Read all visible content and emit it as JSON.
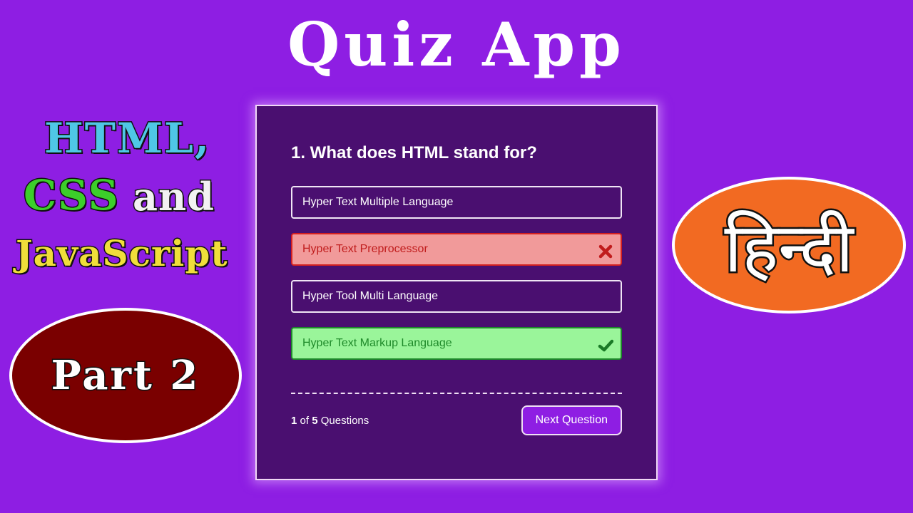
{
  "title": "Quiz App",
  "left_badge": {
    "line1": "HTML,",
    "line2_css": "CSS",
    "line2_and": "and",
    "line3": "JavaScript"
  },
  "part_badge": {
    "label": "Part 2",
    "bg_color": "#7a0000"
  },
  "language_badge": {
    "label": "हिन्दी",
    "bg_color": "#f26a22"
  },
  "quiz": {
    "question": "1. What does HTML stand for?",
    "options": [
      {
        "label": "Hyper Text Multiple Language",
        "state": "neutral"
      },
      {
        "label": "Hyper Text Preprocessor",
        "state": "wrong",
        "icon": "x-icon"
      },
      {
        "label": "Hyper Tool Multi Language",
        "state": "neutral"
      },
      {
        "label": "Hyper Text Markup Language",
        "state": "correct",
        "icon": "check-icon"
      }
    ],
    "progress": {
      "current": "1",
      "of": "of",
      "total": "5",
      "suffix": "Questions"
    },
    "next_button": "Next Question"
  },
  "colors": {
    "background": "#8e1ee3",
    "card": "#4a0f70",
    "wrong": "#f19a9a",
    "correct": "#9af59a"
  }
}
